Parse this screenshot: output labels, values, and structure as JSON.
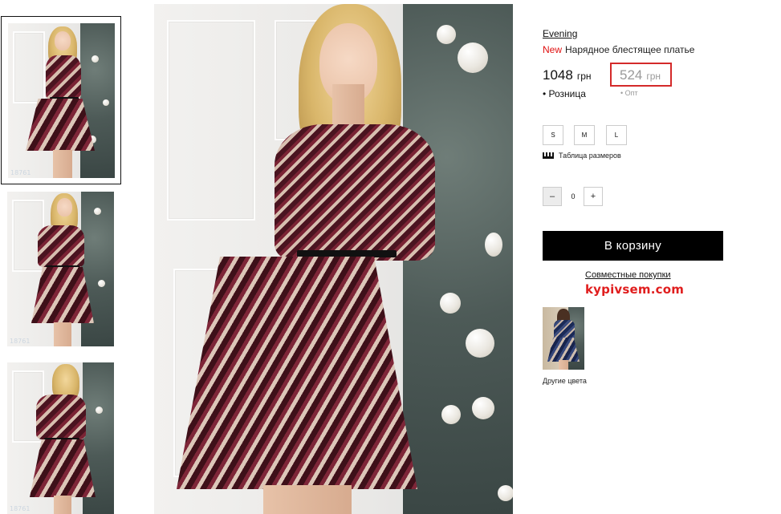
{
  "gallery": {
    "thumbnail_codes": [
      "18761",
      "18761",
      "18761"
    ]
  },
  "product": {
    "brand": "Evening",
    "badge_new": "New",
    "name": "Нарядное блестящее платье",
    "retail_price": "1048",
    "currency": "грн",
    "retail_label": "• Розница",
    "wholesale_price": "524",
    "wholesale_label": "• Опт",
    "sizes": [
      "S",
      "M",
      "L"
    ],
    "size_table_label": "Таблица размеров",
    "quantity": "0",
    "quantity_minus": "–",
    "quantity_plus": "+",
    "add_to_cart_label": "В корзину",
    "joint_purchases_label": "Совместные покупки",
    "joint_purchases_logo": "kypivsem.com",
    "other_colors_label": "Другие цвета"
  },
  "colors": {
    "accent_red": "#e01010",
    "highlight_border": "#d42a2a",
    "button_bg": "#000000"
  }
}
